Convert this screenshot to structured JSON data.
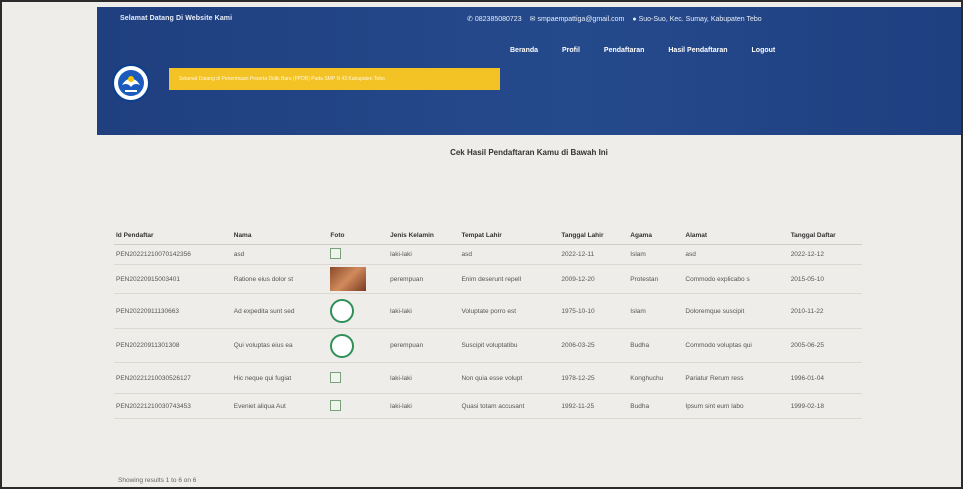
{
  "topbar": {
    "welcome": "Selamat Datang Di Website Kami",
    "phone": "082385080723",
    "email": "smpaempattiga@gmail.com",
    "address": "Suo-Suo, Kec. Sumay, Kabupaten Tebo"
  },
  "nav": [
    "Beranda",
    "Profil",
    "Pendaftaran",
    "Hasil Pendaftaran",
    "Logout"
  ],
  "banner": "Selamat Datang di Penerimaan Peserta Didik Baru (PPDB) Pada SMP N 43 Kabupaten Tebo",
  "page_title": "Cek Hasil Pendaftaran Kamu di Bawah Ini",
  "table": {
    "headers": [
      "Id Pendaftar",
      "Nama",
      "Foto",
      "Jenis Kelamin",
      "Tempat Lahir",
      "Tanggal Lahir",
      "Agama",
      "Alamat",
      "Tanggal Daftar"
    ],
    "rows": [
      [
        "PEN20221210070142356",
        "asd",
        "",
        "laki-laki",
        "asd",
        "2022-12-11",
        "Islam",
        "asd",
        "2022-12-12"
      ],
      [
        "PEN20220915003401",
        "Ratione eius dolor st",
        "",
        "perempuan",
        "Enim deserunt repell",
        "2009-12-20",
        "Protestan",
        "Commodo explicabo s",
        "2015-05-10"
      ],
      [
        "PEN20220911130663",
        "Ad expedita sunt sed",
        "",
        "laki-laki",
        "Voluptate porro est",
        "1975-10-10",
        "Islam",
        "Doloremque suscipit",
        "2010-11-22"
      ],
      [
        "PEN20220911301308",
        "Qui voluptas eius ea",
        "",
        "perempuan",
        "Suscipit voluptatibu",
        "2006-03-25",
        "Budha",
        "Commodo voluptas qui",
        "2005-06-25"
      ],
      [
        "PEN20221210030526127",
        "Hic neque qui fugiat",
        "",
        "laki-laki",
        "Non quia esse volupt",
        "1978-12-25",
        "Konghuchu",
        "Pariatur Rerum ress",
        "1996-01-04"
      ],
      [
        "PEN20221210030743453",
        "Eveniet aliqua Aut",
        "",
        "laki-laki",
        "Quasi totam accusant",
        "1992-11-25",
        "Budha",
        "Ipsum sint eum labo",
        "1999-02-18"
      ]
    ]
  },
  "footer": "Showing results 1 to 6 on 6",
  "colors": {
    "header": "#23478a",
    "banner": "#f3c225",
    "background": "#efedea"
  }
}
